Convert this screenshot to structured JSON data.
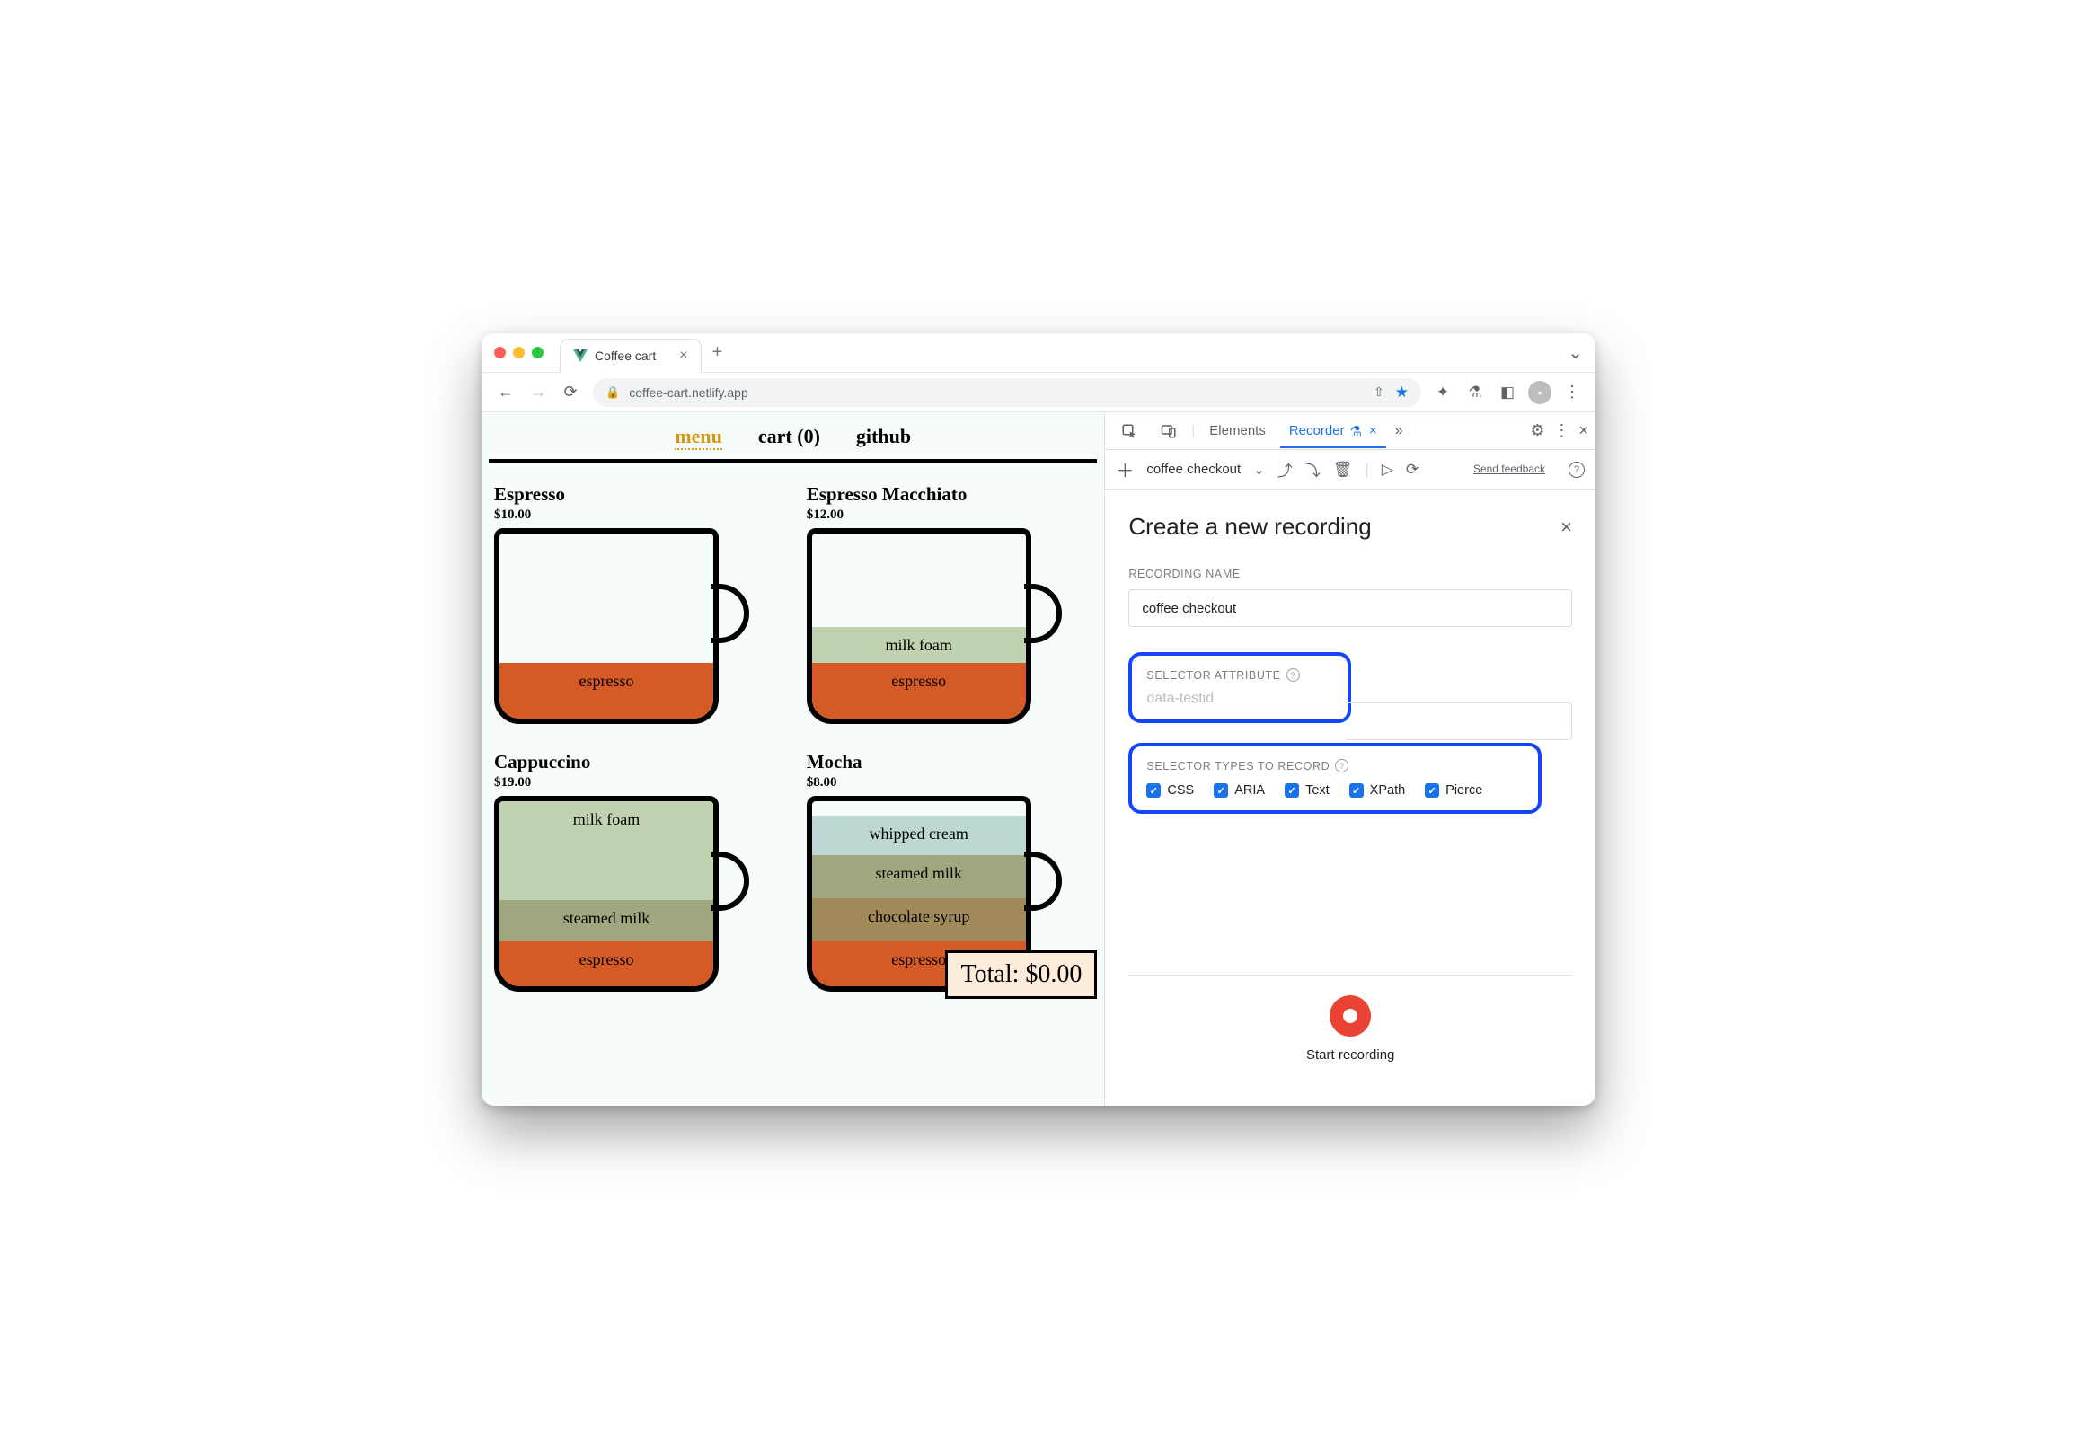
{
  "browser": {
    "tab_title": "Coffee cart",
    "url": "coffee-cart.netlify.app"
  },
  "page": {
    "nav": {
      "menu": "menu",
      "cart": "cart (0)",
      "github": "github"
    },
    "products": [
      {
        "name": "Espresso",
        "price": "$10.00",
        "layers": [
          {
            "label": "espresso",
            "cls": "l-espresso",
            "h": 62
          }
        ]
      },
      {
        "name": "Espresso Macchiato",
        "price": "$12.00",
        "layers": [
          {
            "label": "milk foam",
            "cls": "l-milkfoam",
            "h": 40
          },
          {
            "label": "espresso",
            "cls": "l-espresso",
            "h": 62
          }
        ]
      },
      {
        "name": "Cappuccino",
        "price": "$19.00",
        "layers": [
          {
            "label": "milk foam",
            "cls": "l-milkfoam",
            "h": 110
          },
          {
            "label": "steamed milk",
            "cls": "l-steamed",
            "h": 46
          },
          {
            "label": "espresso",
            "cls": "l-espresso",
            "h": 50
          }
        ]
      },
      {
        "name": "Mocha",
        "price": "$8.00",
        "layers": [
          {
            "label": "whipped cream",
            "cls": "l-whipped",
            "h": 44
          },
          {
            "label": "steamed milk",
            "cls": "l-steamed",
            "h": 48
          },
          {
            "label": "chocolate syrup",
            "cls": "l-choc",
            "h": 48
          },
          {
            "label": "espresso",
            "cls": "l-espresso",
            "h": 50
          }
        ]
      }
    ],
    "total_label": "Total: $0.00"
  },
  "devtools": {
    "tabs": {
      "elements": "Elements",
      "recorder": "Recorder"
    },
    "subbar": {
      "recording_name": "coffee checkout",
      "feedback": "Send feedback"
    },
    "panel": {
      "title": "Create a new recording",
      "recording_name_label": "RECORDING NAME",
      "recording_name_value": "coffee checkout",
      "selector_attr_label": "SELECTOR ATTRIBUTE",
      "selector_attr_placeholder": "data-testid",
      "selector_types_label": "SELECTOR TYPES TO RECORD",
      "selector_types": [
        "CSS",
        "ARIA",
        "Text",
        "XPath",
        "Pierce"
      ],
      "start_recording": "Start recording"
    }
  }
}
